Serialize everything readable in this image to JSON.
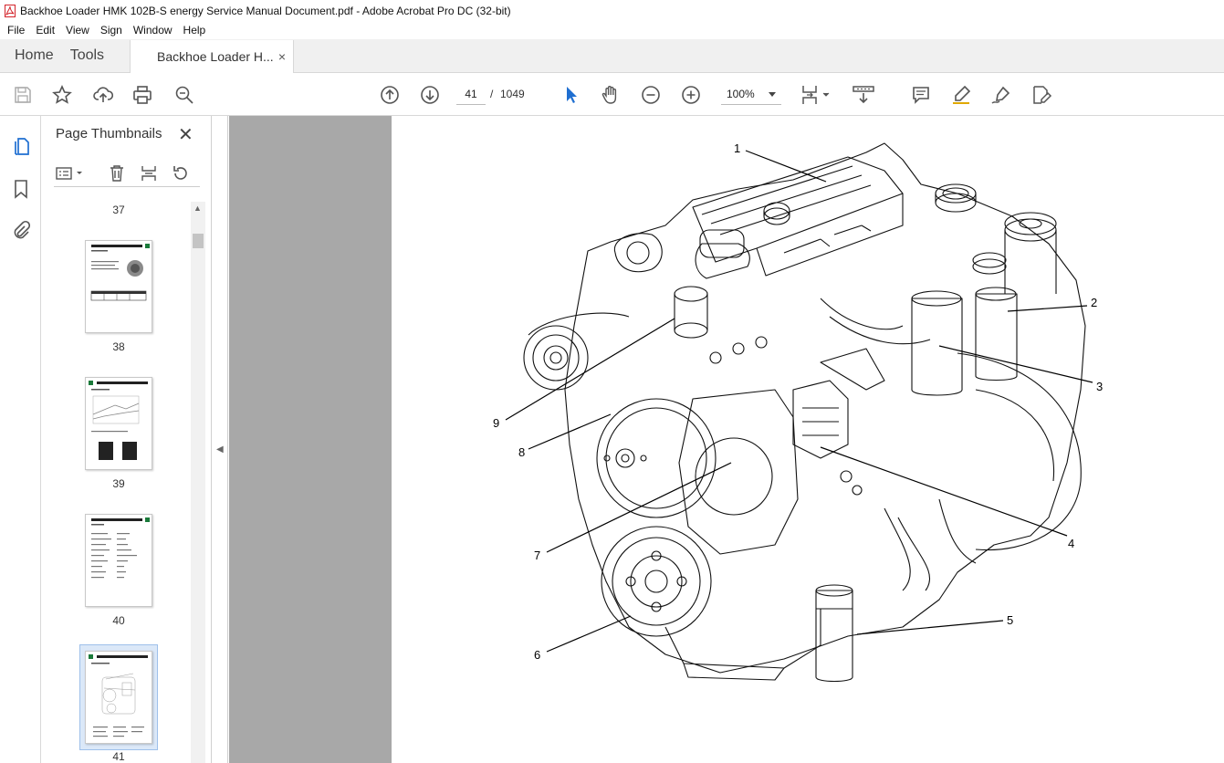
{
  "window": {
    "title": "Backhoe Loader HMK 102B-S energy Service Manual Document.pdf - Adobe Acrobat Pro DC (32-bit)"
  },
  "menu": [
    "File",
    "Edit",
    "View",
    "Sign",
    "Window",
    "Help"
  ],
  "tabs": {
    "home": "Home",
    "tools": "Tools",
    "document": "Backhoe Loader H...",
    "close": "×"
  },
  "toolbar": {
    "current_page": "41",
    "separator": "/",
    "total_pages": "1049",
    "zoom": "100%",
    "icons": [
      "save-icon",
      "star-icon",
      "upload-icon",
      "print-icon",
      "search-zoom-icon",
      "page-up-icon",
      "page-down-icon",
      "select-cursor-icon",
      "hand-icon",
      "zoom-out-icon",
      "zoom-in-icon",
      "fit-page-icon",
      "scroll-mode-icon",
      "comment-icon",
      "highlight-icon",
      "sign-icon",
      "edit-icon"
    ]
  },
  "thumbnails": {
    "title": "Page Thumbnails",
    "close": "✕",
    "pages": [
      "37",
      "38",
      "39",
      "40",
      "41"
    ],
    "selected": "41"
  },
  "document": {
    "callouts": [
      "1",
      "2",
      "3",
      "4",
      "5",
      "6",
      "7",
      "8",
      "9"
    ]
  }
}
